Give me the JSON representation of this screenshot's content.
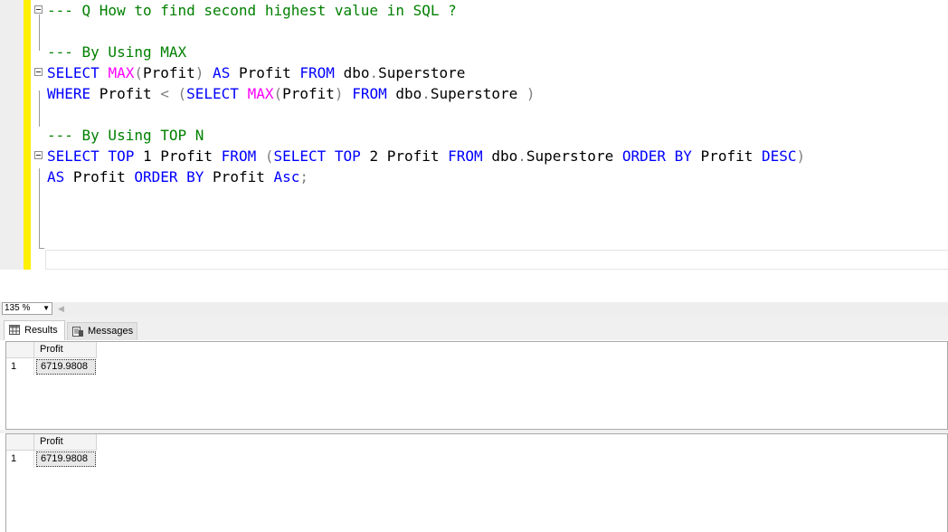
{
  "editor": {
    "lines": [
      [
        {
          "t": "--- Q How to find second highest value in SQL ?",
          "c": "cm"
        }
      ],
      [],
      [
        {
          "t": "--- By Using MAX",
          "c": "cm"
        }
      ],
      [
        {
          "t": "SELECT ",
          "c": "kw"
        },
        {
          "t": "MAX",
          "c": "fn"
        },
        {
          "t": "(",
          "c": "gy"
        },
        {
          "t": "Profit",
          "c": "tx"
        },
        {
          "t": ")",
          "c": "gy"
        },
        {
          "t": " AS ",
          "c": "kw"
        },
        {
          "t": "Profit ",
          "c": "tx"
        },
        {
          "t": "FROM ",
          "c": "kw"
        },
        {
          "t": "dbo",
          "c": "tx"
        },
        {
          "t": ".",
          "c": "gy"
        },
        {
          "t": "Superstore",
          "c": "tx"
        }
      ],
      [
        {
          "t": "WHERE ",
          "c": "kw"
        },
        {
          "t": "Profit ",
          "c": "tx"
        },
        {
          "t": "< (",
          "c": "gy"
        },
        {
          "t": "SELECT ",
          "c": "kw"
        },
        {
          "t": "MAX",
          "c": "fn"
        },
        {
          "t": "(",
          "c": "gy"
        },
        {
          "t": "Profit",
          "c": "tx"
        },
        {
          "t": ") ",
          "c": "gy"
        },
        {
          "t": "FROM ",
          "c": "kw"
        },
        {
          "t": "dbo",
          "c": "tx"
        },
        {
          "t": ".",
          "c": "gy"
        },
        {
          "t": "Superstore ",
          "c": "tx"
        },
        {
          "t": ")",
          "c": "gy"
        }
      ],
      [],
      [
        {
          "t": "--- By Using TOP N",
          "c": "cm"
        }
      ],
      [
        {
          "t": "SELECT TOP ",
          "c": "kw"
        },
        {
          "t": "1 Profit ",
          "c": "tx"
        },
        {
          "t": "FROM ",
          "c": "kw"
        },
        {
          "t": "(",
          "c": "gy"
        },
        {
          "t": "SELECT TOP ",
          "c": "kw"
        },
        {
          "t": "2 Profit ",
          "c": "tx"
        },
        {
          "t": "FROM ",
          "c": "kw"
        },
        {
          "t": "dbo",
          "c": "tx"
        },
        {
          "t": ".",
          "c": "gy"
        },
        {
          "t": "Superstore ",
          "c": "tx"
        },
        {
          "t": "ORDER BY ",
          "c": "kw"
        },
        {
          "t": "Profit ",
          "c": "tx"
        },
        {
          "t": "DESC",
          "c": "kw"
        },
        {
          "t": ")",
          "c": "gy"
        }
      ],
      [
        {
          "t": "AS ",
          "c": "kw"
        },
        {
          "t": "Profit ",
          "c": "tx"
        },
        {
          "t": "ORDER BY ",
          "c": "kw"
        },
        {
          "t": "Profit ",
          "c": "tx"
        },
        {
          "t": "Asc",
          "c": "kw"
        },
        {
          "t": ";",
          "c": "gy"
        }
      ]
    ]
  },
  "zoom": {
    "value": "135 %"
  },
  "tabs": {
    "results": "Results",
    "messages": "Messages"
  },
  "results": [
    {
      "column": "Profit",
      "row_number": "1",
      "value": "6719.9808"
    },
    {
      "column": "Profit",
      "row_number": "1",
      "value": "6719.9808"
    }
  ],
  "colors": {
    "keyword": "#0000ff",
    "function": "#ff00ff",
    "comment": "#008000",
    "operator": "#808080",
    "changebar": "#ffef00"
  }
}
